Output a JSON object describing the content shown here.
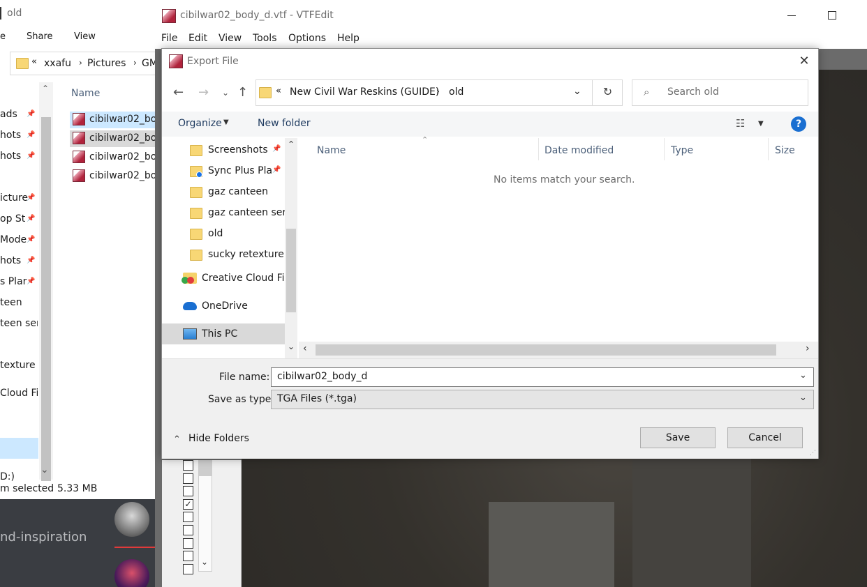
{
  "explorer": {
    "title": "old",
    "ribbon": [
      "Share",
      "View"
    ],
    "breadcrumb": [
      "xxafu",
      "Pictures",
      "GM"
    ],
    "column_name": "Name",
    "nav_items": [
      "ads",
      "hots",
      "hots",
      "",
      "icture",
      "op St",
      "Mode",
      "hots",
      "s Plar",
      "teen",
      "teen serg",
      "",
      "texture g",
      "",
      "Cloud File",
      "",
      "",
      "D:)"
    ],
    "files": [
      "cibilwar02_bo",
      "cibilwar02_bo",
      "cibilwar02_bo",
      "cibilwar02_bo"
    ],
    "status_selected": "m selected",
    "status_size": "5.33 MB"
  },
  "darkapp": {
    "channel_text": "nd-inspiration"
  },
  "vtfedit": {
    "title": "cibilwar02_body_d.vtf - VTFEdit",
    "menu": [
      "File",
      "Edit",
      "View",
      "Tools",
      "Options",
      "Help"
    ]
  },
  "dialog": {
    "title": "Export File",
    "address": [
      "New Civil War Reskins (GUIDE)",
      "old"
    ],
    "search_placeholder": "Search old",
    "organize": "Organize",
    "new_folder": "New folder",
    "nav": [
      {
        "label": "Screenshots",
        "icon": "folder-icon",
        "pinned": true
      },
      {
        "label": "Sync Plus Pla",
        "icon": "sync-folder-icon",
        "pinned": true
      },
      {
        "label": "gaz canteen",
        "icon": "folder-icon",
        "pinned": false
      },
      {
        "label": "gaz canteen serg",
        "icon": "folder-icon",
        "pinned": false
      },
      {
        "label": "old",
        "icon": "folder-icon",
        "pinned": false
      },
      {
        "label": "sucky retexture g",
        "icon": "folder-icon",
        "pinned": false
      }
    ],
    "nav_roots": [
      {
        "label": "Creative Cloud Fil",
        "icon": "creative-cloud-icon"
      },
      {
        "label": "OneDrive",
        "icon": "onedrive-icon"
      },
      {
        "label": "This PC",
        "icon": "this-pc-icon"
      }
    ],
    "columns": [
      "Name",
      "Date modified",
      "Type",
      "Size"
    ],
    "empty_message": "No items match your search.",
    "file_name_label": "File name:",
    "file_name_value": "cibilwar02_body_d",
    "save_type_label": "Save as type:",
    "save_type_value": "TGA Files (*.tga)",
    "hide_folders": "Hide Folders",
    "save": "Save",
    "cancel": "Cancel"
  }
}
